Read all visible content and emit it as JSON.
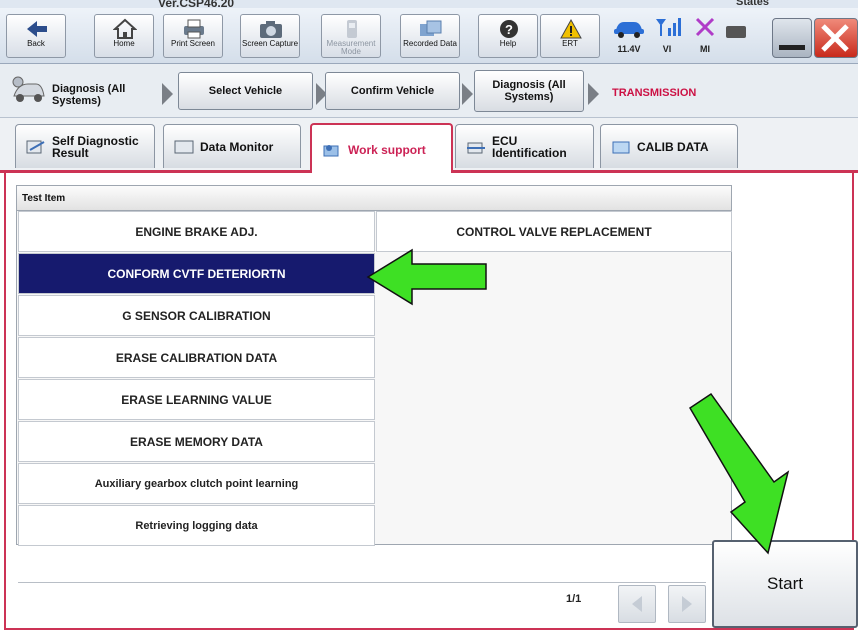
{
  "app": {
    "version": "Ver.CSP46.20",
    "states_label": "States"
  },
  "toolbar": {
    "back": "Back",
    "home": "Home",
    "print_screen": "Print Screen",
    "screen_capture": "Screen Capture",
    "measurement_mode": "Measurement Mode",
    "recorded_data": "Recorded Data",
    "help": "Help",
    "ert": "ERT",
    "battery": "11.4V",
    "vi": "VI",
    "mi": "MI"
  },
  "breadcrumb": {
    "diagnosis_all_systems": "Diagnosis (All Systems)",
    "select_vehicle": "Select Vehicle",
    "confirm_vehicle": "Confirm Vehicle",
    "diagnosis_all_systems_2": "Diagnosis (All Systems)",
    "current": "TRANSMISSION"
  },
  "tabs": {
    "self_diagnostic": "Self Diagnostic Result",
    "data_monitor": "Data Monitor",
    "work_support": "Work support",
    "ecu_identification": "ECU Identification",
    "calib_data": "CALIB DATA"
  },
  "table": {
    "header": "Test Item",
    "left_items": [
      "ENGINE BRAKE ADJ.",
      "CONFORM CVTF DETERIORTN",
      "G SENSOR CALIBRATION",
      "ERASE CALIBRATION DATA",
      "ERASE LEARNING VALUE",
      "ERASE MEMORY DATA",
      "Auxiliary gearbox clutch point learning",
      "Retrieving logging data"
    ],
    "right_items": [
      "CONTROL VALVE REPLACEMENT"
    ],
    "selected_index": 1
  },
  "pagination": {
    "page": "1/1"
  },
  "actions": {
    "start": "Start"
  },
  "colors": {
    "accent": "#cc3355",
    "selected_row": "#161a6e",
    "annotation_arrow": "#33dd22"
  }
}
